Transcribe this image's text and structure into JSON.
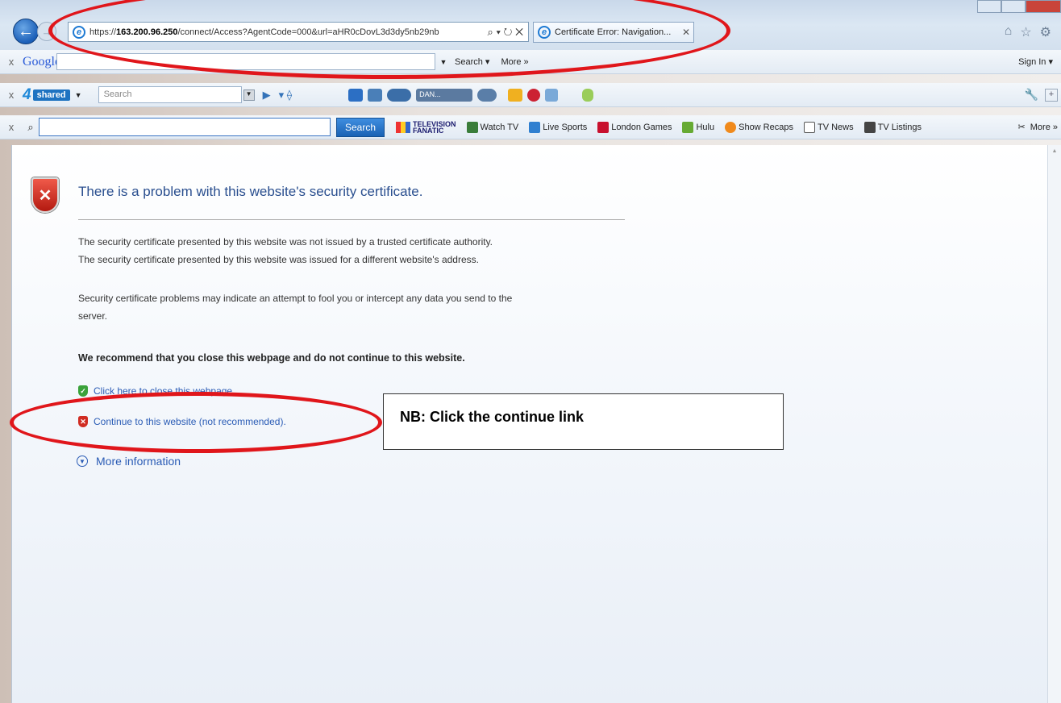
{
  "browser": {
    "back_icon": "back-arrow-icon",
    "forward_icon": "forward-arrow-icon",
    "url_prefix": "https://",
    "url_host": "163.200.96.250",
    "url_path": "/connect/Access?AgentCode=000&url=aHR0cDovL3d3dy5nb29nb",
    "address_tools": "⌕ ▾ ↻ ✕",
    "tab_title": "Certificate Error: Navigation...",
    "tab_close": "✕",
    "home_icon": "⌂",
    "favorites_icon": "☆",
    "tools_icon": "⚙"
  },
  "google_toolbar": {
    "close": "x",
    "logo": "Google",
    "search_label": "Search ▾",
    "more_label": "More »",
    "signin_label": "Sign In ▾"
  },
  "fourshared_toolbar": {
    "close": "x",
    "logo_four": "4",
    "logo_shared": "shared",
    "search_placeholder": "Search",
    "media_track": "DAN..."
  },
  "links_toolbar": {
    "close": "x",
    "search_button": "Search",
    "tv_fanatic_line1": "TELEVISION",
    "tv_fanatic_line2": "FANATIC",
    "links": [
      {
        "label": "Watch TV",
        "color": "#3a7d3a"
      },
      {
        "label": "Live Sports",
        "color": "#2f7fd0"
      },
      {
        "label": "London Games",
        "color": "#c8102e"
      },
      {
        "label": "Hulu",
        "color": "#66aa33"
      },
      {
        "label": "Show Recaps",
        "color": "#f08a1c"
      },
      {
        "label": "TV News",
        "color": "#555555"
      },
      {
        "label": "TV Listings",
        "color": "#444444"
      }
    ],
    "more_label": "More »"
  },
  "page": {
    "title": "There is a problem with this website's security certificate.",
    "para1": "The security certificate presented by this website was not issued by a trusted certificate authority.",
    "para2": "The security certificate presented by this website was issued for a different website's address.",
    "para3": "Security certificate problems may indicate an attempt to fool you or intercept any data you send to the",
    "para4": "server.",
    "recommend": "We recommend that you close this webpage and do not continue to this website.",
    "close_link": "Click here to close this webpage.",
    "continue_link": "Continue to this website (not recommended).",
    "more_info": "More information"
  },
  "annotation": {
    "callout_text": "NB: Click the continue link",
    "highlight_color": "#e0161b"
  }
}
